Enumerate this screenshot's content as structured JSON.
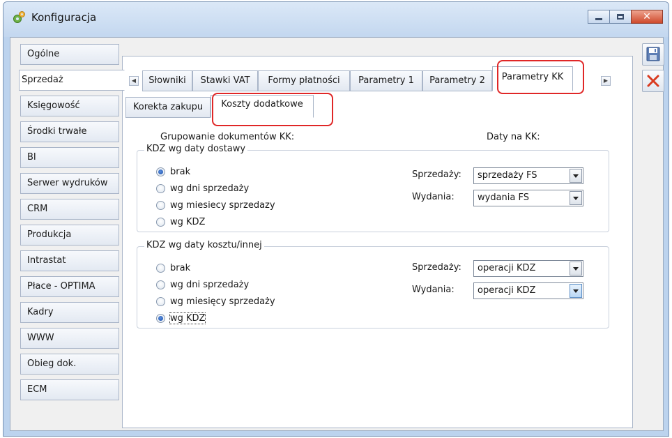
{
  "window": {
    "title": "Konfiguracja"
  },
  "sidebar": {
    "items": [
      {
        "label": "Ogólne"
      },
      {
        "label": "Sprzedaż"
      },
      {
        "label": "Księgowość"
      },
      {
        "label": "Środki trwałe"
      },
      {
        "label": "BI"
      },
      {
        "label": "Serwer wydruków"
      },
      {
        "label": "CRM"
      },
      {
        "label": "Produkcja"
      },
      {
        "label": "Intrastat"
      },
      {
        "label": "Płace - OPTIMA"
      },
      {
        "label": "Kadry"
      },
      {
        "label": "WWW"
      },
      {
        "label": "Obieg dok."
      },
      {
        "label": "ECM"
      }
    ],
    "active": "Sprzedaż"
  },
  "tabs": {
    "row1": [
      "Słowniki",
      "Stawki VAT",
      "Formy płatności",
      "Parametry 1",
      "Parametry 2",
      "Parametry KK"
    ],
    "active_row1": "Parametry KK",
    "row2": [
      "Korekta zakupu",
      "Koszty dodatkowe"
    ],
    "active_row2": "Koszty dodatkowe"
  },
  "content": {
    "grouping_caption": "Grupowanie dokumentów KK:",
    "dates_caption": "Daty na KK:",
    "group1": {
      "legend": "KDZ wg daty dostawy",
      "options": [
        "brak",
        "wg dni sprzedaży",
        "wg miesiecy sprzedazy",
        "wg KDZ"
      ],
      "selected": "brak",
      "sprzedazy_label": "Sprzedaży:",
      "sprzedazy_value": "sprzedaży FS",
      "wydania_label": "Wydania:",
      "wydania_value": "wydania FS"
    },
    "group2": {
      "legend": "KDZ wg daty kosztu/innej",
      "options": [
        "brak",
        "wg dni sprzedaży",
        "wg miesięcy sprzedaży",
        "wg KDZ"
      ],
      "selected": "wg KDZ",
      "sprzedazy_label": "Sprzedaży:",
      "sprzedazy_value": "operacji KDZ",
      "wydania_label": "Wydania:",
      "wydania_value": "operacji KDZ"
    }
  },
  "icons": {
    "save": "save-icon",
    "cancel": "cancel-icon",
    "app": "gear-icon"
  },
  "colors": {
    "highlight": "#e02727",
    "cancel": "#d93a1f"
  }
}
